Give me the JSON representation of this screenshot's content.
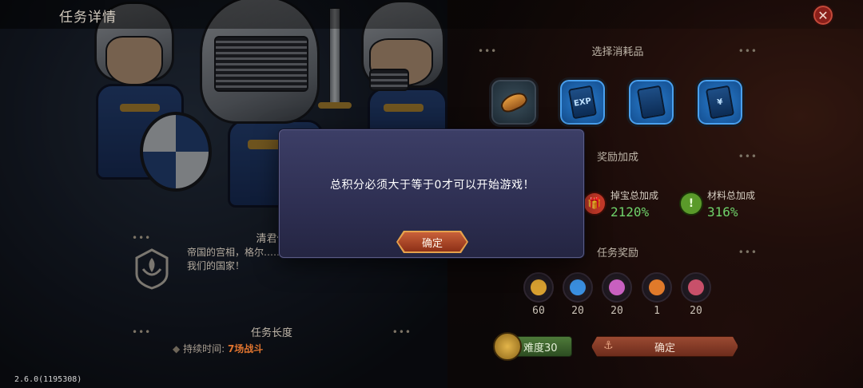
{
  "header": {
    "title": "任务详情",
    "close_icon": "close-icon"
  },
  "left_panel": {
    "section_title": "清君侧",
    "emblem_icon": "guild-emblem-icon",
    "description": "帝国的宫相，格尔……每一个帝国人都该去阻止他，拯救我们的国家！",
    "length_title": "任务长度",
    "duration_label": "持续时间:",
    "duration_value": "7场战斗"
  },
  "right_panel": {
    "consumables_title": "选择消耗品",
    "consumables": [
      {
        "icon": "bread-icon",
        "style": "food"
      },
      {
        "icon": "exp-card-icon",
        "style": "blue",
        "card_text": "EXP"
      },
      {
        "icon": "card-icon",
        "style": "blue",
        "card_text": ""
      },
      {
        "icon": "yen-card-icon",
        "style": "blue",
        "card_text": "¥"
      }
    ],
    "bonus_title": "奖励加成",
    "bonuses": [
      {
        "icon": "treasure-icon",
        "label": "掉宝总加成",
        "value": "2120%",
        "color": "#c83a2a"
      },
      {
        "icon": "material-icon",
        "label": "材料总加成",
        "value": "316%",
        "color": "#5a9a2a"
      }
    ],
    "rewards_title": "任务奖励",
    "rewards": [
      {
        "icon": "gold-coin-icon",
        "count": "60",
        "color": "#d8a030"
      },
      {
        "icon": "blue-gem-icon",
        "count": "20",
        "color": "#3a8fe0"
      },
      {
        "icon": "pink-gem-icon",
        "count": "20",
        "color": "#c860c0"
      },
      {
        "icon": "orange-orb-icon",
        "count": "1",
        "color": "#e07a2a"
      },
      {
        "icon": "rose-gem-icon",
        "count": "20",
        "color": "#c8506a"
      }
    ],
    "difficulty_label": "难度30",
    "confirm_label": "确定"
  },
  "modal": {
    "message": "总积分必须大于等于0才可以开始游戏！",
    "ok_label": "确定"
  },
  "version": "2.6.0(1195308)"
}
